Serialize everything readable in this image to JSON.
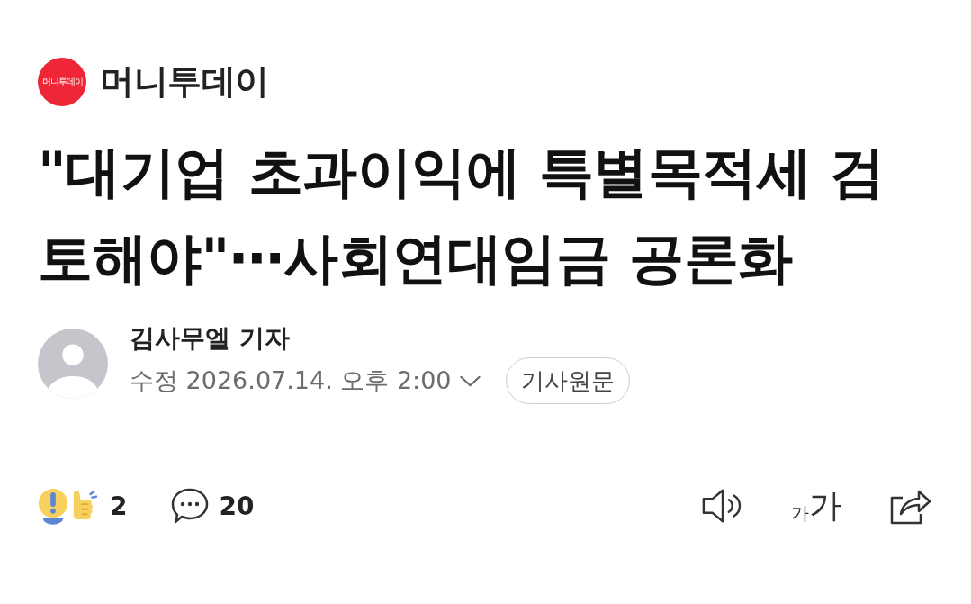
{
  "header": {
    "logo_text": "머니투데이",
    "publisher": "머니투데이"
  },
  "headline": "\"대기업 초과이익에 특별목적세 검토해야\"⋯사회연대임금 공론화",
  "byline": {
    "author": "김사무엘 기자",
    "date": "수정 2026.07.14. 오후 2:00",
    "expanded": false,
    "original_button": "기사원문"
  },
  "actions": {
    "reactions": "2",
    "comments": "20",
    "font_size": [
      "가",
      "가"
    ]
  }
}
